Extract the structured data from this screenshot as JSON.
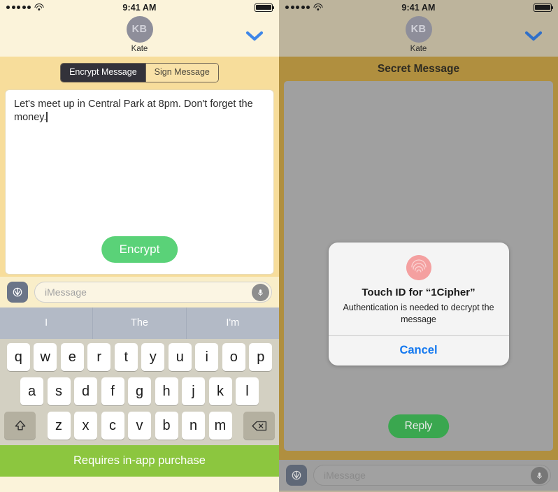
{
  "status_bar": {
    "signal_dots": 5,
    "wifi_icon": "wifi-icon",
    "time": "9:41 AM",
    "battery_icon": "battery-full-icon"
  },
  "left_panel": {
    "contact": {
      "avatar_initials": "KB",
      "name": "Kate",
      "collapse_icon": "chevron-down-icon"
    },
    "segmented_control": {
      "options": [
        {
          "label": "Encrypt Message",
          "selected": true
        },
        {
          "label": "Sign Message",
          "selected": false
        }
      ]
    },
    "compose": {
      "text": "Let's meet up in Central Park at 8pm. Don't forget the money.",
      "submit_label": "Encrypt"
    },
    "imessage_bar": {
      "appstore_icon": "app-store-icon",
      "placeholder": "iMessage",
      "mic_icon": "microphone-icon"
    },
    "predictions": [
      "I",
      "The",
      "I'm"
    ],
    "keyboard": {
      "row1": [
        "q",
        "w",
        "e",
        "r",
        "t",
        "y",
        "u",
        "i",
        "o",
        "p"
      ],
      "row2": [
        "a",
        "s",
        "d",
        "f",
        "g",
        "h",
        "j",
        "k",
        "l"
      ],
      "row3": [
        "z",
        "x",
        "c",
        "v",
        "b",
        "n",
        "m"
      ],
      "shift_icon": "shift-icon",
      "backspace_icon": "backspace-icon"
    },
    "footer_banner": {
      "text": "Requires in-app purchase"
    }
  },
  "right_panel": {
    "contact": {
      "avatar_initials": "KB",
      "name": "Kate",
      "collapse_icon": "chevron-down-icon"
    },
    "secret": {
      "title": "Secret Message",
      "reply_label": "Reply"
    },
    "dialog": {
      "fingerprint_icon": "fingerprint-icon",
      "title": "Touch ID for “1Cipher”",
      "message": "Authentication is needed to decrypt the message",
      "cancel_label": "Cancel"
    },
    "imessage_bar": {
      "appstore_icon": "app-store-icon",
      "placeholder": "iMessage",
      "mic_icon": "microphone-icon"
    }
  },
  "colors": {
    "left_header_bg": "#fbf3da",
    "left_app_bg": "#f7dd9b",
    "encrypt_green": "#5ad278",
    "banner_green": "#8cc63f",
    "keyboard_bg": "#d3d0c2",
    "predictive_bg": "#b3bac6",
    "right_header_bg": "#bdb49c",
    "right_app_bg": "#b08f3f",
    "secret_body_bg": "#a0a0a0",
    "reply_green": "#3aa74f",
    "dialog_bg": "#f4f4f4",
    "cancel_blue": "#1378f0",
    "fingerprint_pink": "#f4a0a0",
    "chevron_blue": "#3e86e8"
  }
}
